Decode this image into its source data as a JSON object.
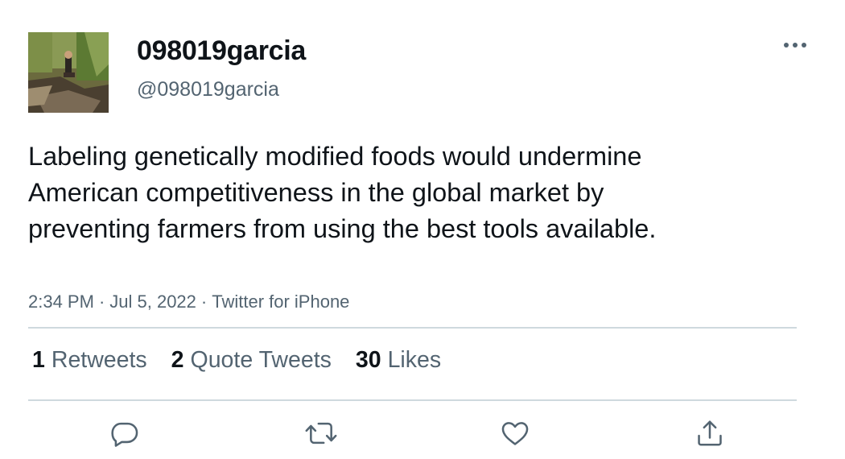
{
  "author": {
    "display_name": "098019garcia",
    "handle": "@098019garcia"
  },
  "tweet": {
    "text": "Labeling genetically modified foods would undermine American competitiveness in the global market by preventing farmers from using the best tools available.",
    "time": "2:34 PM",
    "date": "Jul 5, 2022",
    "source": "Twitter for iPhone",
    "separator": "·"
  },
  "stats": {
    "retweets_count": "1",
    "retweets_label": "Retweets",
    "quotes_count": "2",
    "quotes_label": "Quote Tweets",
    "likes_count": "30",
    "likes_label": "Likes"
  },
  "icons": {
    "more": "more-horizontal-icon",
    "reply": "reply-icon",
    "retweet": "retweet-icon",
    "like": "heart-icon",
    "share": "share-icon"
  },
  "colors": {
    "text_primary": "#0f1419",
    "text_secondary": "#536471",
    "divider": "#cfd9de",
    "icon": "#536471"
  }
}
